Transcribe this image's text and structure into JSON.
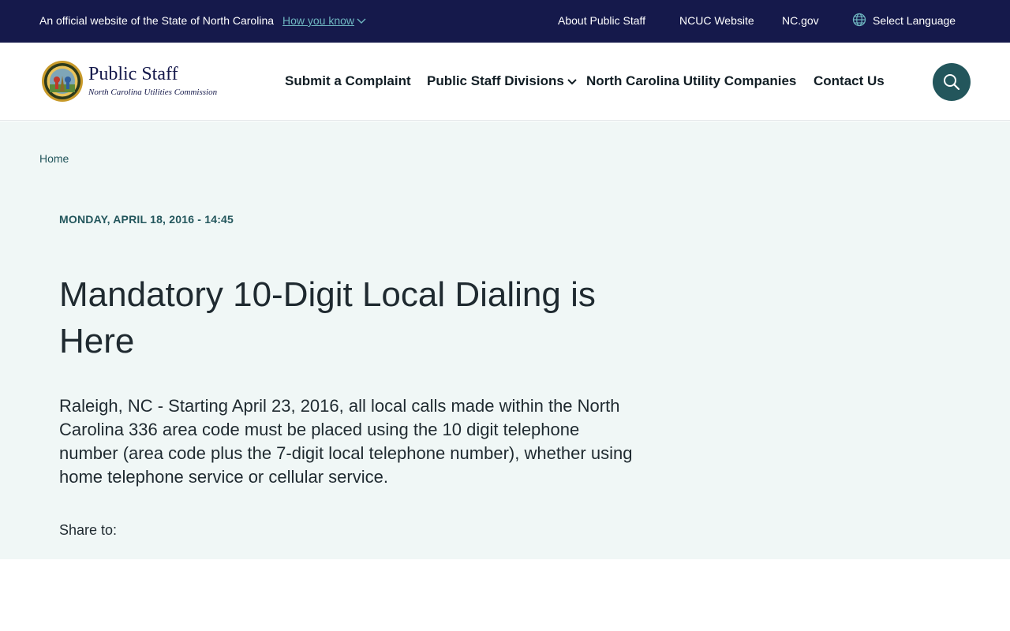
{
  "utility_bar": {
    "official_text": "An official website of the State of North Carolina",
    "how_you_know": "How you know",
    "links": {
      "about": "About Public Staff",
      "ncuc": "NCUC Website",
      "ncgov": "NC.gov"
    },
    "language_label": "Select Language",
    "background_color": "#15194b"
  },
  "header": {
    "logo_title": "Public Staff",
    "logo_subtitle": "North Carolina Utilities Commission",
    "nav": {
      "complaint": "Submit a Complaint",
      "divisions": "Public Staff Divisions",
      "companies": "North Carolina Utility Companies",
      "contact": "Contact Us"
    },
    "search_button_color": "#23565c",
    "icons": [
      "seal-logo",
      "chevron-down-icon",
      "search-icon",
      "globe-icon"
    ]
  },
  "breadcrumb": {
    "home": "Home"
  },
  "article": {
    "date": "MONDAY, APRIL 18, 2016 - 14:45",
    "title": "Mandatory 10-Digit Local Dialing is Here",
    "body": "Raleigh, NC - Starting April 23, 2016, all local calls made within the North Carolina 336 area code must be placed using the 10 digit telephone number (area code plus the 7-digit local telephone number), whether using home telephone service or cellular service.",
    "share_label": "Share to:"
  },
  "colors": {
    "accent_teal": "#23565c",
    "content_background": "#f0f7f6"
  }
}
